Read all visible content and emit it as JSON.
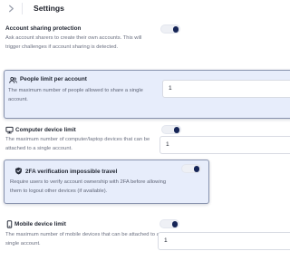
{
  "header": {
    "title": "Settings"
  },
  "settings": [
    {
      "title": "Account sharing protection",
      "description": "Ask account sharers to create their own accounts. This will trigger challenges if account sharing is detected.",
      "enabled": true
    },
    {
      "title": "People limit per account",
      "description": "The maximum number of people allowed to share a single account.",
      "value": "1"
    },
    {
      "title": "Computer device limit",
      "description": "The maximum number of computer/laptop devices that can be attached to a single account.",
      "enabled": true,
      "value": "1"
    },
    {
      "title": "2FA verification impossible travel",
      "description": "Require users to verify account ownership with 2FA before allowing them to logout other devices (if available).",
      "enabled": true
    },
    {
      "title": "Mobile device limit",
      "description": "The maximum number of mobile devices that can be attached to a single account.",
      "enabled": true,
      "value": "1"
    }
  ]
}
